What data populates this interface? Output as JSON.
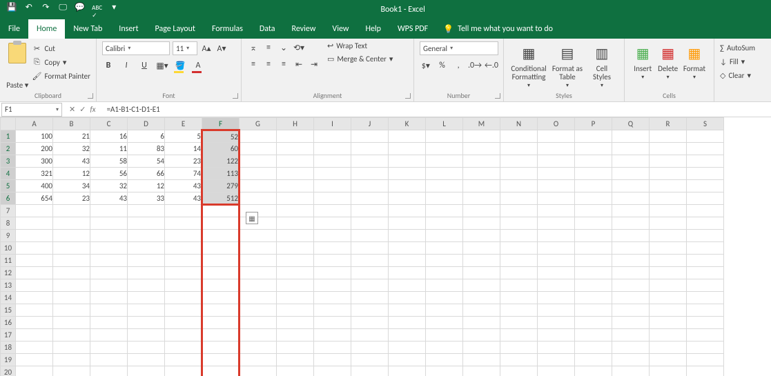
{
  "app": {
    "title": "Book1  -  Excel"
  },
  "qat": {
    "save": "💾",
    "undo": "↶",
    "redo": "↷",
    "monitor": "🖵",
    "speech": "💬",
    "spell": "✓",
    "custom": "▾"
  },
  "tabs": {
    "file": "File",
    "home": "Home",
    "newtab": "New Tab",
    "insert": "Insert",
    "pagelayout": "Page Layout",
    "formulas": "Formulas",
    "data": "Data",
    "review": "Review",
    "view": "View",
    "help": "Help",
    "wps": "WPS PDF",
    "tell": "Tell me what you want to do"
  },
  "clipboard": {
    "paste": "Paste",
    "cut": "Cut",
    "copy": "Copy",
    "painter": "Format Painter",
    "label": "Clipboard"
  },
  "font": {
    "name": "Calibri",
    "size": "11",
    "label": "Font",
    "bold": "B",
    "italic": "I",
    "underline": "U"
  },
  "align": {
    "wrap": "Wrap Text",
    "merge": "Merge & Center",
    "label": "Alignment"
  },
  "number": {
    "format": "General",
    "label": "Number"
  },
  "styles": {
    "cond": "Conditional Formatting",
    "table": "Format as Table",
    "cell": "Cell Styles",
    "label": "Styles"
  },
  "cells": {
    "insert": "Insert",
    "delete": "Delete",
    "format": "Format",
    "label": "Cells"
  },
  "editing": {
    "sum": "AutoSum",
    "fill": "Fill",
    "clear": "Clear"
  },
  "formula": {
    "ref": "F1",
    "fx": "fx",
    "content": "=A1-B1-C1-D1-E1"
  },
  "cols": [
    "A",
    "B",
    "C",
    "D",
    "E",
    "F",
    "G",
    "H",
    "I",
    "J",
    "K",
    "L",
    "M",
    "N",
    "O",
    "P",
    "Q",
    "R",
    "S"
  ],
  "rows": 20,
  "data_rows": [
    {
      "A": 100,
      "B": 21,
      "C": 16,
      "D": 6,
      "E": 5,
      "F": 52
    },
    {
      "A": 200,
      "B": 32,
      "C": 11,
      "D": 83,
      "E": 14,
      "F": 60
    },
    {
      "A": 300,
      "B": 43,
      "C": 58,
      "D": 54,
      "E": 23,
      "F": 122
    },
    {
      "A": 321,
      "B": 12,
      "C": 56,
      "D": 66,
      "E": 74,
      "F": 113
    },
    {
      "A": 400,
      "B": 34,
      "C": 32,
      "D": 12,
      "E": 43,
      "F": 279
    },
    {
      "A": 654,
      "B": 23,
      "C": 43,
      "D": 33,
      "E": 43,
      "F": 512
    }
  ],
  "selected_col": "F",
  "selected_rows": [
    1,
    6
  ]
}
